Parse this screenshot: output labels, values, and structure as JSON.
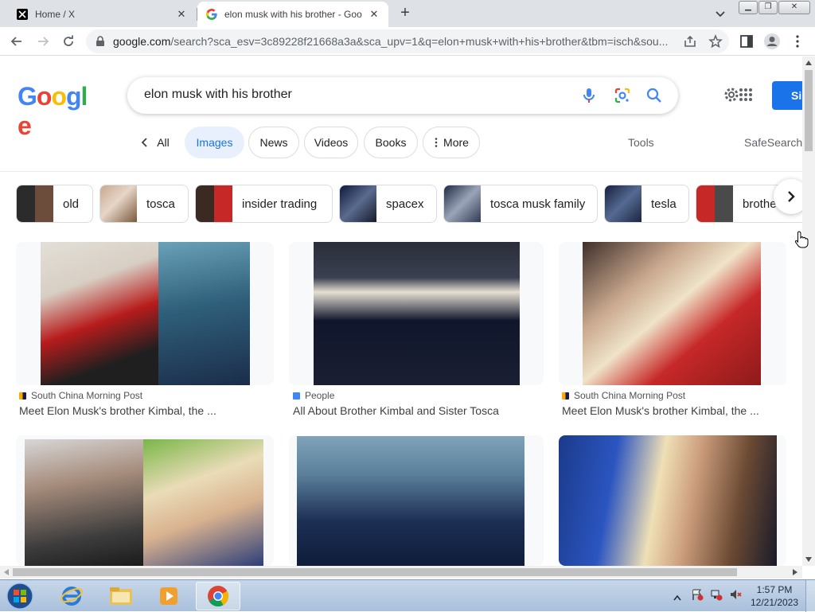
{
  "tabs": [
    {
      "title": "Home / X",
      "favicon": "x-logo-icon",
      "active": false
    },
    {
      "title": "elon musk with his brother - Goo",
      "favicon": "google-g-icon",
      "active": true
    }
  ],
  "omnibox": {
    "host": "google.com",
    "path": "/search?sca_esv=3c89228f21668a3a&sca_upv=1&q=elon+musk+with+his+brother&tbm=isch&sou..."
  },
  "google": {
    "logo_letters": [
      "G",
      "o",
      "o",
      "g",
      "l",
      "e"
    ],
    "query": "elon musk with his brother",
    "signin_label": "Si",
    "tabs": [
      {
        "label": "All"
      },
      {
        "label": "Images"
      },
      {
        "label": "News"
      },
      {
        "label": "Videos"
      },
      {
        "label": "Books"
      },
      {
        "label": "More"
      }
    ],
    "tools_label": "Tools",
    "safesearch_label": "SafeSearch"
  },
  "suggestions": [
    {
      "label": "old"
    },
    {
      "label": "tosca"
    },
    {
      "label": "insider trading"
    },
    {
      "label": "spacex"
    },
    {
      "label": "tosca musk family"
    },
    {
      "label": "tesla"
    },
    {
      "label": "brothe"
    }
  ],
  "results": [
    {
      "source": "South China Morning Post",
      "title": "Meet Elon Musk's brother Kimbal, the ...",
      "src_color": "#f9ab00"
    },
    {
      "source": "People",
      "title": "All About Brother Kimbal and Sister Tosca",
      "src_color": "#4285f4"
    },
    {
      "source": "South China Morning Post",
      "title": "Meet Elon Musk's brother Kimbal, the ...",
      "src_color": "#f9ab00"
    }
  ],
  "taskbar": {
    "time": "1:57 PM",
    "date": "12/21/2023"
  },
  "colors": {
    "accent": "#1a73e8",
    "chip_selected_bg": "#e8f0fe"
  }
}
